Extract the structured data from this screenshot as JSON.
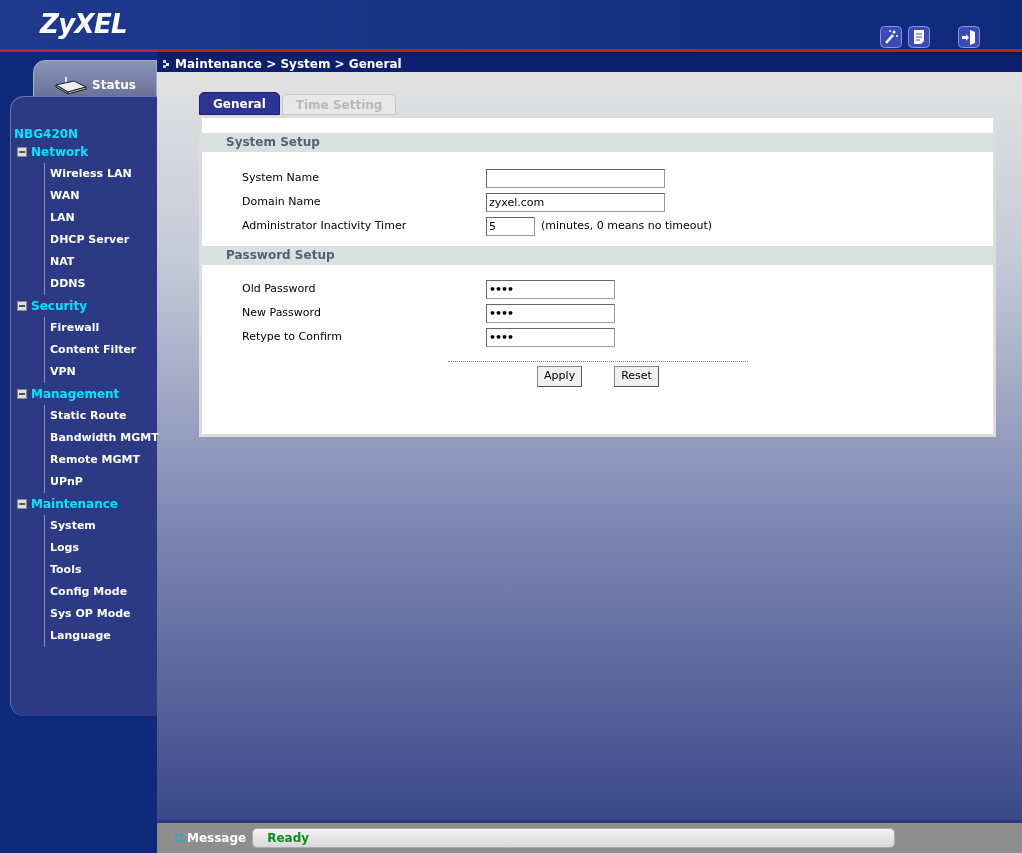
{
  "header": {
    "logo": "ZyXEL"
  },
  "status_tab": {
    "label": "Status"
  },
  "device": "NBG420N",
  "nav": [
    {
      "label": "Network",
      "expanded": true,
      "children": [
        {
          "label": "Wireless LAN"
        },
        {
          "label": "WAN"
        },
        {
          "label": "LAN"
        },
        {
          "label": "DHCP Server"
        },
        {
          "label": "NAT"
        },
        {
          "label": "DDNS"
        }
      ]
    },
    {
      "label": "Security",
      "expanded": true,
      "children": [
        {
          "label": "Firewall"
        },
        {
          "label": "Content Filter"
        },
        {
          "label": "VPN"
        }
      ]
    },
    {
      "label": "Management",
      "expanded": true,
      "children": [
        {
          "label": "Static Route"
        },
        {
          "label": "Bandwidth MGMT"
        },
        {
          "label": "Remote MGMT"
        },
        {
          "label": "UPnP"
        }
      ]
    },
    {
      "label": "Maintenance",
      "expanded": true,
      "children": [
        {
          "label": "System"
        },
        {
          "label": "Logs"
        },
        {
          "label": "Tools"
        },
        {
          "label": "Config Mode"
        },
        {
          "label": "Sys OP Mode"
        },
        {
          "label": "Language"
        }
      ]
    }
  ],
  "breadcrumb": "Maintenance > System > General",
  "tabs": [
    {
      "label": "General",
      "selected": true
    },
    {
      "label": "Time Setting",
      "selected": false
    }
  ],
  "sections": [
    {
      "title": "System Setup",
      "fields": [
        {
          "label": "System Name",
          "kind": "wide"
        },
        {
          "label": "Domain Name",
          "kind": "wide",
          "value": "zyxel.com"
        },
        {
          "label": "Administrator Inactivity Timer",
          "kind": "short",
          "value": "5",
          "hint": "(minutes, 0 means no timeout)"
        }
      ]
    },
    {
      "title": "Password Setup",
      "fields": [
        {
          "label": "Old Password",
          "kind": "password",
          "value": "••••"
        },
        {
          "label": "New Password",
          "kind": "password",
          "value": "••••"
        },
        {
          "label": "Retype to Confirm",
          "kind": "password",
          "value": "••••"
        }
      ]
    }
  ],
  "buttons": [
    "Apply",
    "Reset"
  ],
  "status_bar": {
    "label": "Message",
    "value": "Ready"
  }
}
